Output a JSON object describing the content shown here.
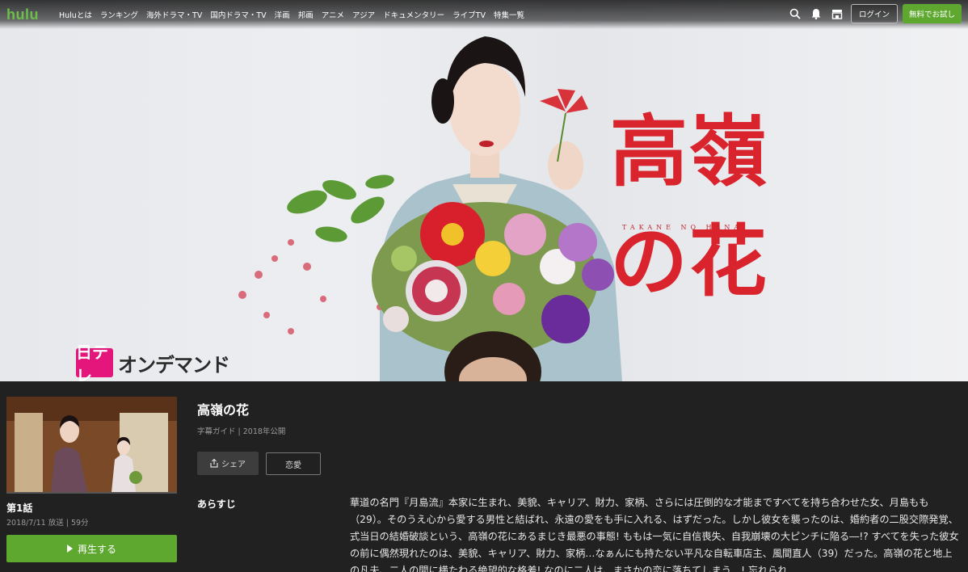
{
  "header": {
    "logo": "hulu",
    "nav": [
      "Huluとは",
      "ランキング",
      "海外ドラマ・TV",
      "国内ドラマ・TV",
      "洋画",
      "邦画",
      "アニメ",
      "アジア",
      "ドキュメンタリー",
      "ライブTV",
      "特集一覧"
    ],
    "icons": [
      "search-icon",
      "bell-icon",
      "store-icon"
    ],
    "login_label": "ログイン",
    "trial_label": "無料でお試し"
  },
  "hero": {
    "title_line1": "高嶺",
    "title_line2": "の花",
    "title_romaji": "TAKANE NO HANA",
    "channel_badge": "日テレ",
    "channel_text": "オンデマンド",
    "accent_color": "#d9232d"
  },
  "episode": {
    "title": "第1話",
    "meta": "2018/7/11 放送 | 59分",
    "play_label": "再生する"
  },
  "series": {
    "title": "高嶺の花",
    "meta": "字幕ガイド | 2018年公開",
    "share_label": "シェア",
    "genre_label": "恋愛",
    "synopsis_label": "あらすじ",
    "synopsis": "華道の名門『月島流』本家に生まれ、美貌、キャリア、財力、家柄、さらには圧倒的な才能まですべてを持ち合わせた女、月島もも（29）。そのうえ心から愛する男性と結ばれ、永遠の愛をも手に入れる、はずだった。しかし彼女を襲ったのは、婚約者の二股交際発覚、式当日の結婚破談という、高嶺の花にあるまじき最悪の事態! ももは一気に自信喪失、自我崩壊の大ピンチに陥る―!? すべてを失った彼女の前に偶然現れたのは、美貌、キャリア、財力、家柄…なぁんにも持たない平凡な自転車店主、風間直人（39）だった。高嶺の花と地上の凡夫、二人の間に横たわる絶望的な格差! なのに二人は、まさかの恋に落ちてしまう…! 忘れられ"
  },
  "colors": {
    "brand_green": "#6cc04a",
    "button_green": "#5fa830",
    "background": "#212121"
  }
}
